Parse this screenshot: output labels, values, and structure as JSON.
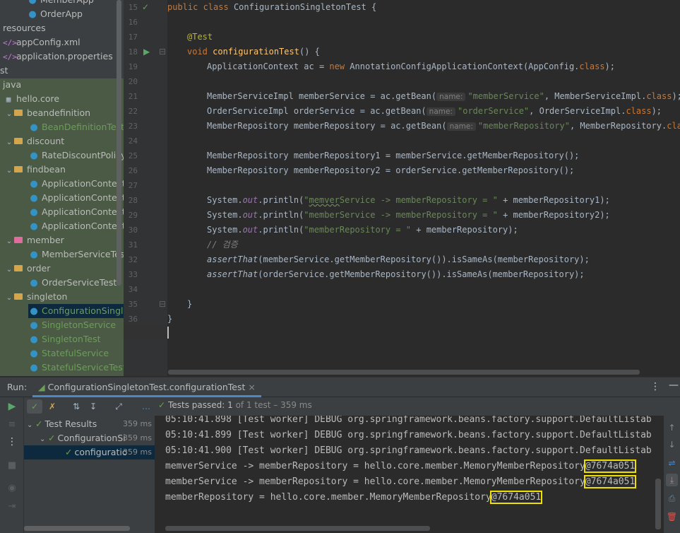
{
  "project_tree": [
    {
      "label": "MemberApp",
      "icon": "class-icon",
      "style": "normal"
    },
    {
      "label": "OrderApp",
      "icon": "class-icon",
      "style": "normal"
    },
    {
      "label": "resources",
      "icon": "",
      "style": "normal"
    },
    {
      "label": "appConfig.xml",
      "icon": "xml-icon",
      "style": "normal"
    },
    {
      "label": "application.properties",
      "icon": "properties-icon",
      "style": "normal"
    },
    {
      "label": "st",
      "icon": "",
      "style": "normal"
    },
    {
      "label": "java",
      "icon": "",
      "style": "normal"
    },
    {
      "label": "hello.core",
      "icon": "package-icon",
      "style": "normal"
    },
    {
      "label": "beandefinition",
      "icon": "folder-icon",
      "style": "normal"
    },
    {
      "label": "BeanDefinitionTest",
      "icon": "class-icon",
      "style": "green"
    },
    {
      "label": "discount",
      "icon": "folder-icon",
      "style": "normal"
    },
    {
      "label": "RateDiscountPolicyTe",
      "icon": "class-icon",
      "style": "normal"
    },
    {
      "label": "findbean",
      "icon": "folder-icon",
      "style": "normal"
    },
    {
      "label": "ApplicationContextBa",
      "icon": "class-icon",
      "style": "normal"
    },
    {
      "label": "ApplicationContextEx",
      "icon": "class-icon",
      "style": "normal"
    },
    {
      "label": "ApplicationContextIn",
      "icon": "class-icon",
      "style": "normal"
    },
    {
      "label": "ApplicationContextSa",
      "icon": "class-icon",
      "style": "normal"
    },
    {
      "label": "member",
      "icon": "folder-icon",
      "style": "normal"
    },
    {
      "label": "MemberServiceTest",
      "icon": "class-icon",
      "style": "normal"
    },
    {
      "label": "order",
      "icon": "folder-icon",
      "style": "normal"
    },
    {
      "label": "OrderServiceTest",
      "icon": "class-icon",
      "style": "normal"
    },
    {
      "label": "singleton",
      "icon": "folder-icon",
      "style": "normal"
    },
    {
      "label": "ConfigurationSingleto",
      "icon": "class-icon",
      "style": "green"
    },
    {
      "label": "SingletonService",
      "icon": "class-icon",
      "style": "green"
    },
    {
      "label": "SingletonTest",
      "icon": "class-icon",
      "style": "green"
    },
    {
      "label": "StatefulService",
      "icon": "class-icon",
      "style": "green"
    },
    {
      "label": "StatefulServiceTest",
      "icon": "class-icon",
      "style": "green"
    }
  ],
  "editor": {
    "line_numbers": [
      "15",
      "16",
      "17",
      "18",
      "19",
      "20",
      "21",
      "22",
      "23",
      "24",
      "25",
      "26",
      "27",
      "28",
      "29",
      "30",
      "31",
      "32",
      "33",
      "34",
      "35",
      "36",
      "37"
    ],
    "class_decl": {
      "kw": "public class",
      "name": "ConfigurationSingletonTest",
      "tail": " {"
    },
    "annotation": "@Test",
    "method_decl": {
      "kw": "void",
      "name": "configurationTest",
      "tail": "() {"
    },
    "l19": {
      "a": "ApplicationContext ac = ",
      "kw": "new",
      "b": " AnnotationConfigApplicationContext(AppConfig.",
      "kw2": "class",
      "c": ");"
    },
    "l21": {
      "a": "MemberServiceImpl memberService = ac.getBean(",
      "hint": "name:",
      "str": "\"memberService\"",
      "b": ", MemberServiceImpl.",
      "kw": "class",
      "c": ");"
    },
    "l22": {
      "a": "OrderServiceImpl orderService = ac.getBean(",
      "hint": "name:",
      "str": "\"orderService\"",
      "b": ", OrderServiceImpl.",
      "kw": "class",
      "c": ");"
    },
    "l23": {
      "a": "MemberRepository memberRepository = ac.getBean(",
      "hint": "name:",
      "str": "\"memberRepository\"",
      "b": ", MemberRepository.",
      "kw": "class",
      "c": ");"
    },
    "l25": "MemberRepository memberRepository1 = memberService.getMemberRepository();",
    "l26": "MemberRepository memberRepository2 = orderService.getMemberRepository();",
    "l28": {
      "a": "System.",
      "fld": "out",
      "b": ".println(",
      "str1": "\"",
      "squig": "memver",
      "str2": "Service -> memberRepository = \"",
      "c": " + memberRepository1);"
    },
    "l29": {
      "a": "System.",
      "fld": "out",
      "b": ".println(",
      "str": "\"memberService -> memberRepository = \"",
      "c": " + memberRepository2);"
    },
    "l30": {
      "a": "System.",
      "fld": "out",
      "b": ".println(",
      "str": "\"memberRepository = \"",
      "c": " + memberRepository);"
    },
    "l31": "// 검증",
    "l32": {
      "fn": "assertThat",
      "b": "(memberService.getMemberRepository()).isSameAs(memberRepository);"
    },
    "l33": {
      "fn": "assertThat",
      "b": "(orderService.getMemberRepository()).isSameAs(memberRepository);"
    },
    "close_method": "}",
    "close_class": "}"
  },
  "run": {
    "label": "Run:",
    "tab_title": "ConfigurationSingletonTest.configurationTest",
    "close": "×",
    "tests_passed_label": "Tests passed:",
    "tests_passed_count": "1",
    "tests_passed_rest": "of 1 test – 359 ms",
    "test_tree": [
      {
        "label": "Test Results",
        "time": "359 ms"
      },
      {
        "label": "ConfigurationSi",
        "time": "359 ms"
      },
      {
        "label": "configuratio",
        "time": "359 ms"
      }
    ]
  },
  "console": {
    "debug_lines": [
      "05:10:41.898 [Test worker] DEBUG org.springframework.beans.factory.support.DefaultListab",
      "05:10:41.899 [Test worker] DEBUG org.springframework.beans.factory.support.DefaultListab",
      "05:10:41.900 [Test worker] DEBUG org.springframework.beans.factory.support.DefaultListab"
    ],
    "out1": {
      "text": "memverService -> memberRepository = hello.core.member.MemoryMemberRepository",
      "hash": "@7674a051"
    },
    "out2": {
      "text": "memberService -> memberRepository = hello.core.member.MemoryMemberRepository",
      "hash": "@7674a051"
    },
    "out3": {
      "text": "memberRepository = hello.core.member.MemoryMemberRepository",
      "hash": "@7674a051"
    }
  },
  "colors": {
    "highlight_box": "#f0e000",
    "passed_green": "#6a9f55",
    "keyword": "#cc7832",
    "string": "#6a8759"
  }
}
